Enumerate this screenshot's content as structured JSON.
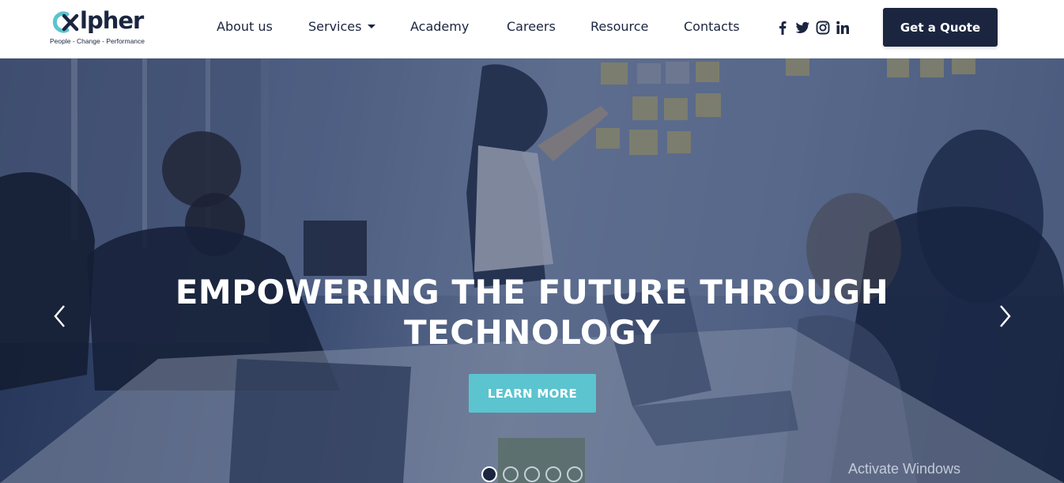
{
  "brand": {
    "logo_text": "lpher",
    "tagline": "People - Change - Performance",
    "primary_color": "#1b2540",
    "accent_color": "#5bc4cf"
  },
  "nav": {
    "items": [
      {
        "label": "About us"
      },
      {
        "label": "Services",
        "has_dropdown": true
      },
      {
        "label": "Academy"
      },
      {
        "label": "Careers"
      },
      {
        "label": "Resource"
      },
      {
        "label": "Contacts"
      }
    ]
  },
  "social": [
    "facebook-icon",
    "twitter-icon",
    "instagram-icon",
    "linkedin-icon"
  ],
  "header": {
    "cta_label": "Get a Quote"
  },
  "hero": {
    "title_line1": "EMPOWERING THE FUTURE THROUGH",
    "title_line2": "TECHNOLOGY",
    "button_label": "LEARN MORE",
    "slide_count": 5,
    "active_slide": 1
  },
  "system": {
    "watermark": "Activate Windows"
  }
}
